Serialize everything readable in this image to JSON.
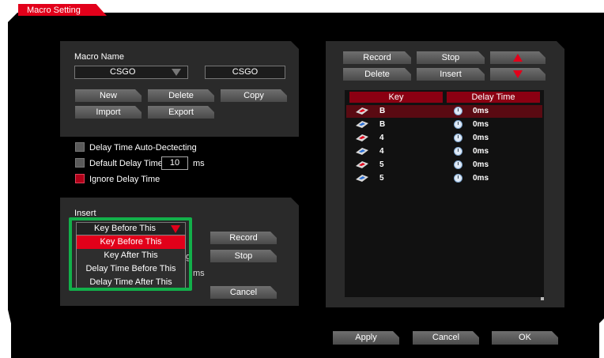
{
  "window": {
    "title": "Macro Setting"
  },
  "macro_panel": {
    "name_label": "Macro Name",
    "selected_macro": "CSGO",
    "name_field_value": "CSGO",
    "buttons": {
      "new": "New",
      "delete": "Delete",
      "copy": "Copy",
      "import": "Import",
      "export": "Export"
    }
  },
  "options": {
    "auto_detect_label": "Delay Time Auto-Dectecting",
    "auto_detect_checked": false,
    "default_delay_label": "Default Delay Time",
    "default_delay_checked": false,
    "default_delay_value": "10",
    "default_delay_unit": "ms",
    "ignore_delay_label": "Ignore Delay Time",
    "ignore_delay_checked": true
  },
  "insert_panel": {
    "label": "Insert",
    "selected": "Key Before This",
    "options": [
      "Key Before This",
      "Key After This",
      "Delay Time Before This",
      "Delay Time After This"
    ],
    "peek_text_g": "g",
    "peek_text_ms": "ms",
    "buttons": {
      "record": "Record",
      "stop": "Stop",
      "cancel": "Cancel"
    }
  },
  "right_panel": {
    "buttons": {
      "record": "Record",
      "stop": "Stop",
      "delete": "Delete",
      "insert": "Insert"
    },
    "columns": {
      "key": "Key",
      "delay": "Delay Time"
    },
    "rows": [
      {
        "key": "B",
        "delay": "0ms",
        "action": "down",
        "selected": true
      },
      {
        "key": "B",
        "delay": "0ms",
        "action": "up",
        "selected": false
      },
      {
        "key": "4",
        "delay": "0ms",
        "action": "down",
        "selected": false
      },
      {
        "key": "4",
        "delay": "0ms",
        "action": "up",
        "selected": false
      },
      {
        "key": "5",
        "delay": "0ms",
        "action": "down",
        "selected": false
      },
      {
        "key": "5",
        "delay": "0ms",
        "action": "up",
        "selected": false
      }
    ]
  },
  "footer": {
    "apply": "Apply",
    "cancel": "Cancel",
    "ok": "OK"
  },
  "colors": {
    "accent": "#e2001a",
    "highlight": "#12b04a",
    "panel": "#2a2a2a"
  }
}
